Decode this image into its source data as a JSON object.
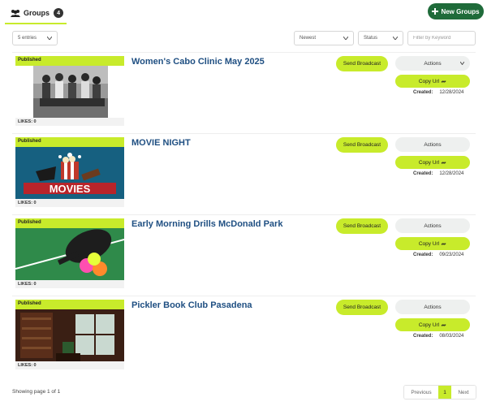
{
  "header": {
    "tab_label": "Groups",
    "tab_count": "4",
    "new_button_label": "New Groups"
  },
  "toolbar": {
    "entries_value": "5 entries",
    "sort_value": "Newest",
    "status_value": "Status",
    "keyword_placeholder": "Filter by Keyword"
  },
  "groups": [
    {
      "status": "Published",
      "title": "Women's Cabo Clinic May 2025",
      "likes": "LIKES: 0",
      "broadcast_label": "Send Broadcast",
      "actions_label": "Actions",
      "copy_label": "Copy Url",
      "created_label": "Created:",
      "created_date": "12/28/2024"
    },
    {
      "status": "Published",
      "title": "MOVIE NIGHT",
      "likes": "LIKES: 0",
      "broadcast_label": "Send Broadcast",
      "actions_label": "Actions",
      "copy_label": "Copy Url",
      "created_label": "Created:",
      "created_date": "12/28/2024",
      "image_text": "MOVIES"
    },
    {
      "status": "Published",
      "title": "Early Morning Drills McDonald Park",
      "likes": "LIKES: 0",
      "broadcast_label": "Send Broadcast",
      "actions_label": "Actions",
      "copy_label": "Copy Url",
      "created_label": "Created:",
      "created_date": "09/23/2024"
    },
    {
      "status": "Published",
      "title": "Pickler Book Club Pasadena",
      "likes": "LIKES: 0",
      "broadcast_label": "Send Broadcast",
      "actions_label": "Actions",
      "copy_label": "Copy Url",
      "created_label": "Created:",
      "created_date": "08/03/2024"
    }
  ],
  "footer": {
    "showing": "Showing page 1 of 1",
    "prev": "Previous",
    "page": "1",
    "next": "Next"
  },
  "colors": {
    "accent_lime": "#c8eb2b",
    "primary_green": "#1f6b3a",
    "title_blue": "#1f4f82"
  },
  "icons": {
    "tab": "users-icon",
    "new": "plus-icon",
    "copy": "link-icon",
    "dropdown": "chevron-down-icon"
  }
}
